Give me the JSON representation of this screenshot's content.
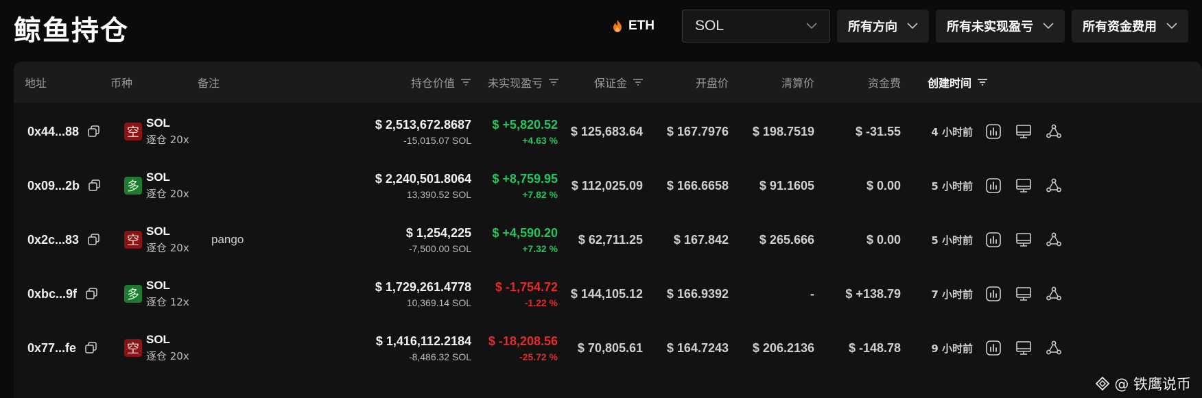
{
  "page": {
    "title": "鲸鱼持仓"
  },
  "filters": {
    "eth_label": "ETH",
    "coin_select_value": "SOL",
    "direction_label": "所有方向",
    "pnl_label": "所有未实现盈亏",
    "funding_label": "所有资金费用"
  },
  "table": {
    "headers": {
      "address": "地址",
      "coin": "币种",
      "note": "备注",
      "position_value": "持仓价值",
      "unrealized_pnl": "未实现盈亏",
      "margin": "保证金",
      "entry_price": "开盘价",
      "liq_price": "清算价",
      "funding": "资金费",
      "created": "创建时间"
    },
    "rows": [
      {
        "address": "0x44...88",
        "direction": "空",
        "dir_type": "short",
        "coin": "SOL",
        "leverage": "逐仓 20x",
        "note": "",
        "position_value": "$ 2,513,672.8687",
        "position_size": "-15,015.07 SOL",
        "pnl": "$ +5,820.52",
        "pnl_pct": "+4.63 %",
        "pnl_sign": "green",
        "margin": "$ 125,683.64",
        "entry": "$ 167.7976",
        "liq": "$ 198.7519",
        "funding": "$ -31.55",
        "funding_sign": "red",
        "created": "4 小时前"
      },
      {
        "address": "0x09...2b",
        "direction": "多",
        "dir_type": "long",
        "coin": "SOL",
        "leverage": "逐仓 20x",
        "note": "",
        "position_value": "$ 2,240,501.8064",
        "position_size": "13,390.52 SOL",
        "pnl": "$ +8,759.95",
        "pnl_pct": "+7.82 %",
        "pnl_sign": "green",
        "margin": "$ 112,025.09",
        "entry": "$ 166.6658",
        "liq": "$ 91.1605",
        "funding": "$ 0.00",
        "funding_sign": "muted",
        "created": "5 小时前"
      },
      {
        "address": "0x2c...83",
        "direction": "空",
        "dir_type": "short",
        "coin": "SOL",
        "leverage": "逐仓 20x",
        "note": "pango",
        "position_value": "$ 1,254,225",
        "position_size": "-7,500.00 SOL",
        "pnl": "$ +4,590.20",
        "pnl_pct": "+7.32 %",
        "pnl_sign": "green",
        "margin": "$ 62,711.25",
        "entry": "$ 167.842",
        "liq": "$ 265.666",
        "funding": "$ 0.00",
        "funding_sign": "muted",
        "created": "5 小时前"
      },
      {
        "address": "0xbc...9f",
        "direction": "多",
        "dir_type": "long",
        "coin": "SOL",
        "leverage": "逐仓 12x",
        "note": "",
        "position_value": "$ 1,729,261.4778",
        "position_size": "10,369.14 SOL",
        "pnl": "$ -1,754.72",
        "pnl_pct": "-1.22 %",
        "pnl_sign": "red",
        "margin": "$ 144,105.12",
        "entry": "$ 166.9392",
        "liq": "-",
        "funding": "$ +138.79",
        "funding_sign": "green",
        "created": "7 小时前"
      },
      {
        "address": "0x77...fe",
        "direction": "空",
        "dir_type": "short",
        "coin": "SOL",
        "leverage": "逐仓 20x",
        "note": "",
        "position_value": "$ 1,416,112.2184",
        "position_size": "-8,486.32 SOL",
        "pnl": "$ -18,208.56",
        "pnl_pct": "-25.72 %",
        "pnl_sign": "red",
        "margin": "$ 70,805.61",
        "entry": "$ 164.7243",
        "liq": "$ 206.2136",
        "funding": "$ -148.78",
        "funding_sign": "red",
        "created": "9 小时前"
      }
    ]
  },
  "watermark": {
    "text": "@ 铁鹰说币"
  },
  "colors": {
    "green": "#22c55e",
    "red": "#e52a2a",
    "short_badge": "#8a1414",
    "long_badge": "#1e7a2e"
  }
}
